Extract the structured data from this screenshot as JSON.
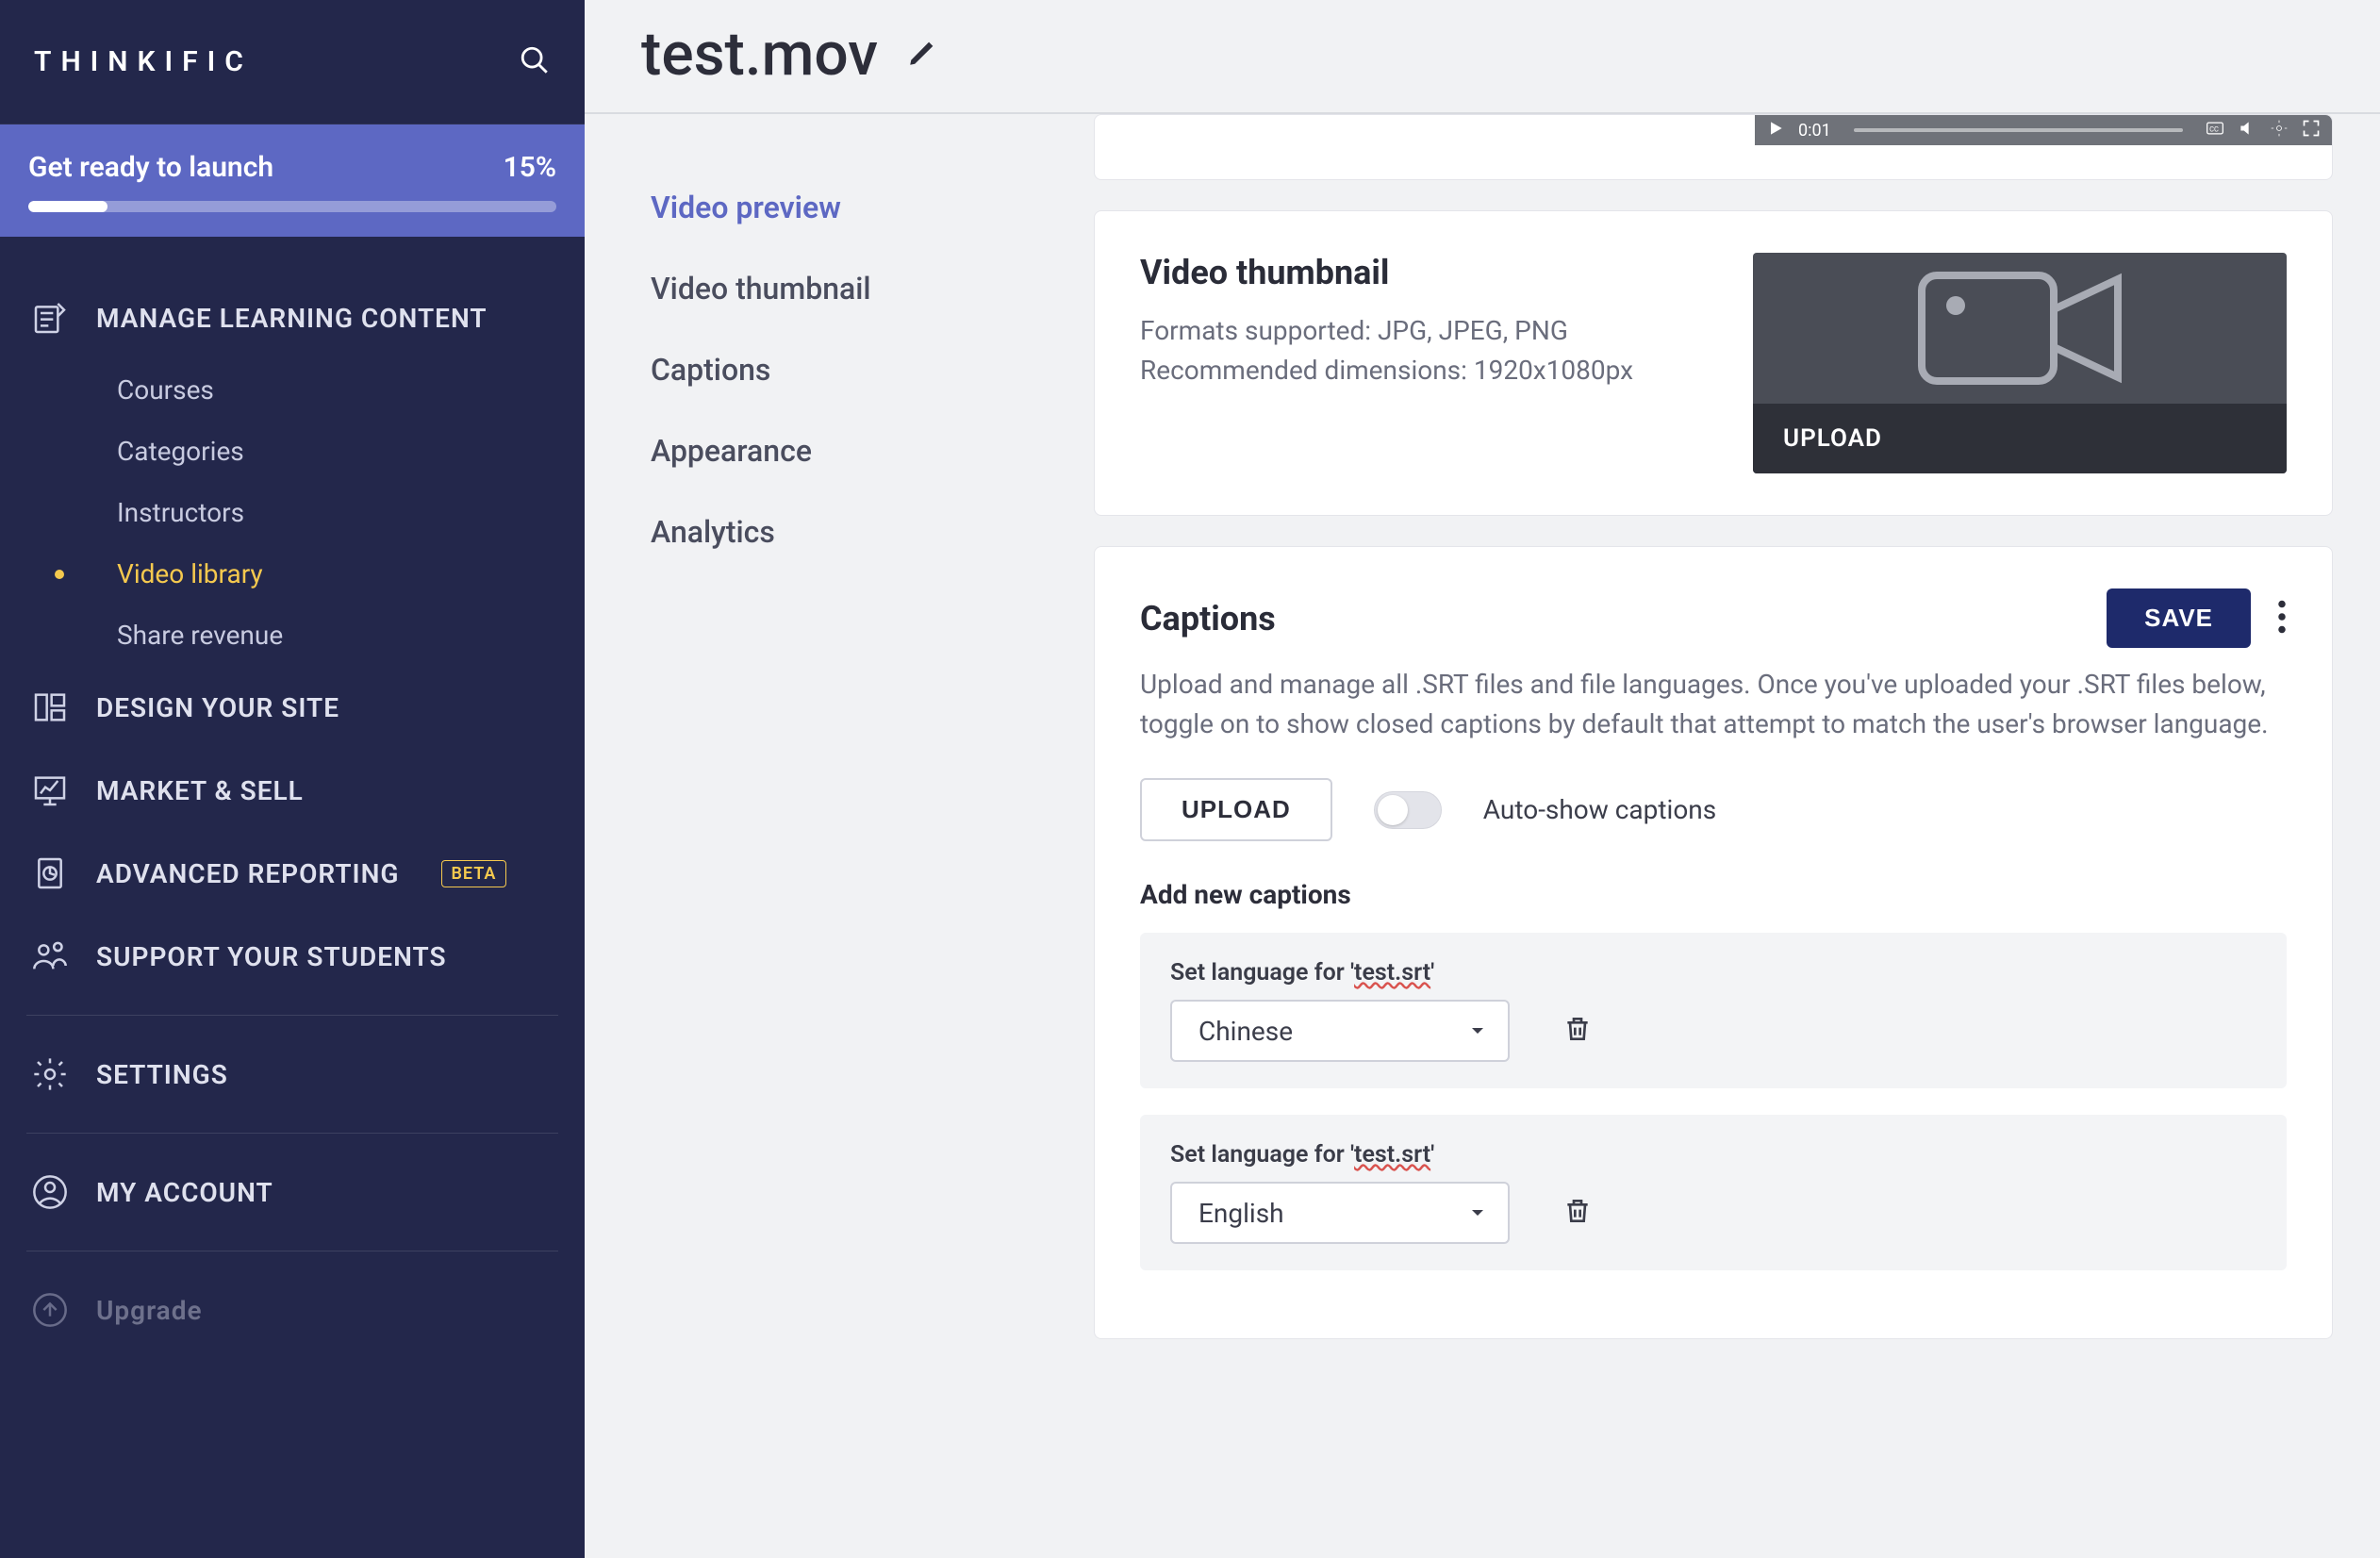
{
  "brand": "THINKIFIC",
  "launch": {
    "label": "Get ready to launch",
    "percent": "15%",
    "progress_pct": 15
  },
  "sidebar": {
    "manage_label": "MANAGE LEARNING CONTENT",
    "subs": [
      {
        "label": "Courses"
      },
      {
        "label": "Categories"
      },
      {
        "label": "Instructors"
      },
      {
        "label": "Video library",
        "active": true
      },
      {
        "label": "Share revenue"
      }
    ],
    "items": [
      {
        "label": "DESIGN YOUR SITE"
      },
      {
        "label": "MARKET & SELL"
      },
      {
        "label": "ADVANCED REPORTING",
        "badge": "BETA"
      },
      {
        "label": "SUPPORT YOUR STUDENTS"
      }
    ],
    "bottom": [
      {
        "label": "SETTINGS"
      },
      {
        "label": "MY ACCOUNT"
      },
      {
        "label": "Upgrade"
      }
    ]
  },
  "page": {
    "title": "test.mov"
  },
  "snav": [
    {
      "label": "Video preview",
      "active": true
    },
    {
      "label": "Video thumbnail"
    },
    {
      "label": "Captions"
    },
    {
      "label": "Appearance"
    },
    {
      "label": "Analytics"
    }
  ],
  "video_bar": {
    "time": "0:01"
  },
  "thumbnail": {
    "heading": "Video thumbnail",
    "formats": "Formats supported: JPG, JPEG, PNG",
    "dims": "Recommended dimensions: 1920x1080px",
    "upload_label": "UPLOAD"
  },
  "captions": {
    "heading": "Captions",
    "save_label": "SAVE",
    "desc": "Upload and manage all .SRT files and file languages. Once you've uploaded your .SRT files below, toggle on to show closed captions by default that attempt to match the user's browser language.",
    "upload_label": "UPLOAD",
    "toggle_label": "Auto-show captions",
    "add_heading": "Add new captions",
    "items": [
      {
        "label_prefix": "Set language for '",
        "filename": "test.srt",
        "label_suffix": "'",
        "selected": "Chinese"
      },
      {
        "label_prefix": "Set language for '",
        "filename": "test.srt",
        "label_suffix": "'",
        "selected": "English"
      }
    ]
  }
}
